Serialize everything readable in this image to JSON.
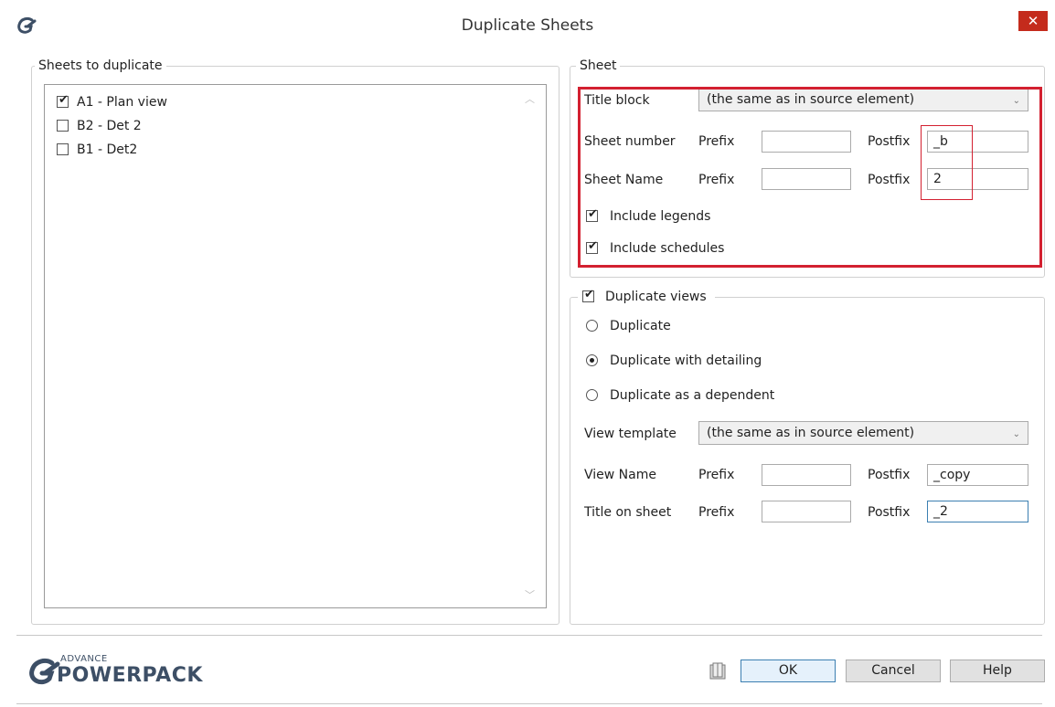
{
  "window": {
    "title": "Duplicate Sheets",
    "close_symbol": "✕"
  },
  "sheets_to_duplicate": {
    "legend": "Sheets to duplicate",
    "items": [
      {
        "label": "A1 - Plan view",
        "checked": true
      },
      {
        "label": "B2 - Det 2",
        "checked": false
      },
      {
        "label": "B1 - Det2",
        "checked": false
      }
    ]
  },
  "sheet": {
    "legend": "Sheet",
    "title_block_label": "Title block",
    "title_block_value": "(the same as in source element)",
    "sheet_number_label": "Sheet number",
    "sheet_name_label": "Sheet Name",
    "prefix_label": "Prefix",
    "postfix_label": "Postfix",
    "sheet_number_prefix": "",
    "sheet_number_postfix": "_b",
    "sheet_name_prefix": "",
    "sheet_name_postfix": "2",
    "include_legends_label": "Include legends",
    "include_legends_checked": true,
    "include_schedules_label": "Include schedules",
    "include_schedules_checked": true
  },
  "duplicate_views": {
    "legend": "Duplicate views",
    "checked": true,
    "options": [
      {
        "label": "Duplicate",
        "selected": false
      },
      {
        "label": "Duplicate with detailing",
        "selected": true
      },
      {
        "label": "Duplicate as a dependent",
        "selected": false
      }
    ],
    "view_template_label": "View template",
    "view_template_value": "(the same as in source element)",
    "view_name_label": "View Name",
    "title_on_sheet_label": "Title on sheet",
    "prefix_label": "Prefix",
    "postfix_label": "Postfix",
    "view_name_prefix": "",
    "view_name_postfix": "_copy",
    "title_on_sheet_prefix": "",
    "title_on_sheet_postfix": "_2"
  },
  "footer": {
    "logo_small": "ADVANCE",
    "logo_large": "POWERPACK",
    "ok_label": "OK",
    "cancel_label": "Cancel",
    "help_label": "Help"
  },
  "colors": {
    "highlight_red": "#d32030",
    "logo_blue": "#3d4f66",
    "close_red": "#c42b1c"
  }
}
